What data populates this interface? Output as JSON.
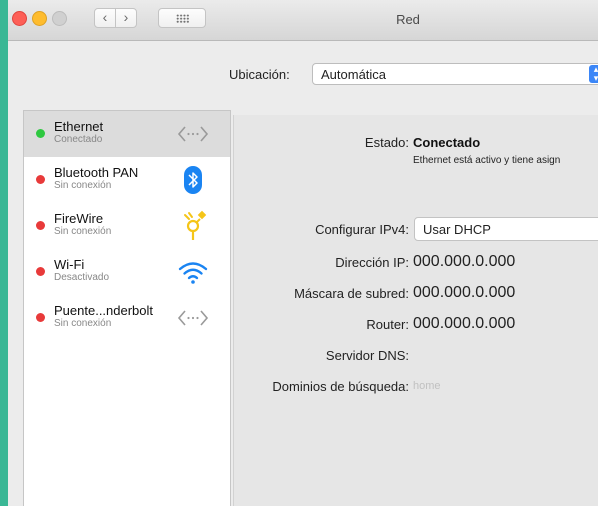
{
  "window": {
    "title": "Red"
  },
  "toolbar": {
    "back": "‹",
    "forward": "›"
  },
  "location": {
    "label": "Ubicación:",
    "value": "Automática"
  },
  "sidebar": {
    "items": [
      {
        "name": "Ethernet",
        "status": "Conectado",
        "state_color": "#2ec840",
        "icon": "ethernet-arrows-icon"
      },
      {
        "name": "Bluetooth PAN",
        "status": "Sin conexión",
        "state_color": "#e83a3a",
        "icon": "bluetooth-icon"
      },
      {
        "name": "FireWire",
        "status": "Sin conexión",
        "state_color": "#e83a3a",
        "icon": "firewire-icon"
      },
      {
        "name": "Wi-Fi",
        "status": "Desactivado",
        "state_color": "#e83a3a",
        "icon": "wifi-icon"
      },
      {
        "name": "Puente...nderbolt",
        "status": "Sin conexión",
        "state_color": "#e83a3a",
        "icon": "thunderbolt-bridge-arrows-icon"
      }
    ]
  },
  "details": {
    "status_label": "Estado:",
    "status_value": "Conectado",
    "status_desc": "Ethernet está activo y tiene asign",
    "ipv4_label": "Configurar IPv4:",
    "ipv4_value": "Usar DHCP",
    "ip_label": "Dirección IP:",
    "ip_value": "000.000.0.000",
    "mask_label": "Máscara de subred:",
    "mask_value": "000.000.0.000",
    "router_label": "Router:",
    "router_value": "000.000.0.000",
    "dns_label": "Servidor DNS:",
    "search_label": "Dominios de búsqueda:",
    "search_value": "home"
  },
  "colors": {
    "accent": "#3b86f7",
    "frame": "#3ab795",
    "connected": "#2ec840",
    "disconnected": "#e83a3a"
  }
}
